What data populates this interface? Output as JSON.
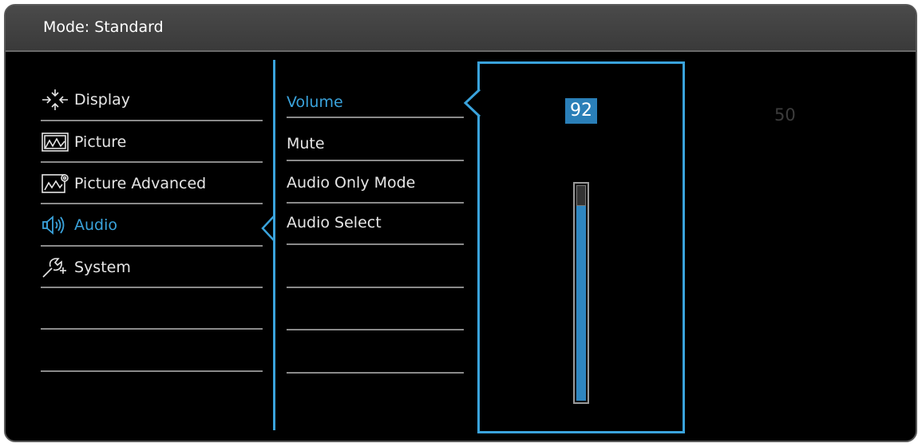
{
  "title": "Mode: Standard",
  "menu": {
    "items": [
      {
        "label": "Display",
        "icon": "display-icon"
      },
      {
        "label": "Picture",
        "icon": "picture-icon"
      },
      {
        "label": "Picture Advanced",
        "icon": "picture-advanced-icon"
      },
      {
        "label": "Audio",
        "icon": "audio-icon"
      },
      {
        "label": "System",
        "icon": "system-icon"
      }
    ],
    "active": "Audio"
  },
  "submenu": {
    "items": [
      {
        "label": "Volume"
      },
      {
        "label": "Mute"
      },
      {
        "label": "Audio Only Mode"
      },
      {
        "label": "Audio Select"
      }
    ],
    "active": "Volume"
  },
  "volume": {
    "value": "92",
    "level": 0.92,
    "default_value": "50"
  },
  "colors": {
    "accent": "#3aa3dc",
    "background": "#000000"
  }
}
